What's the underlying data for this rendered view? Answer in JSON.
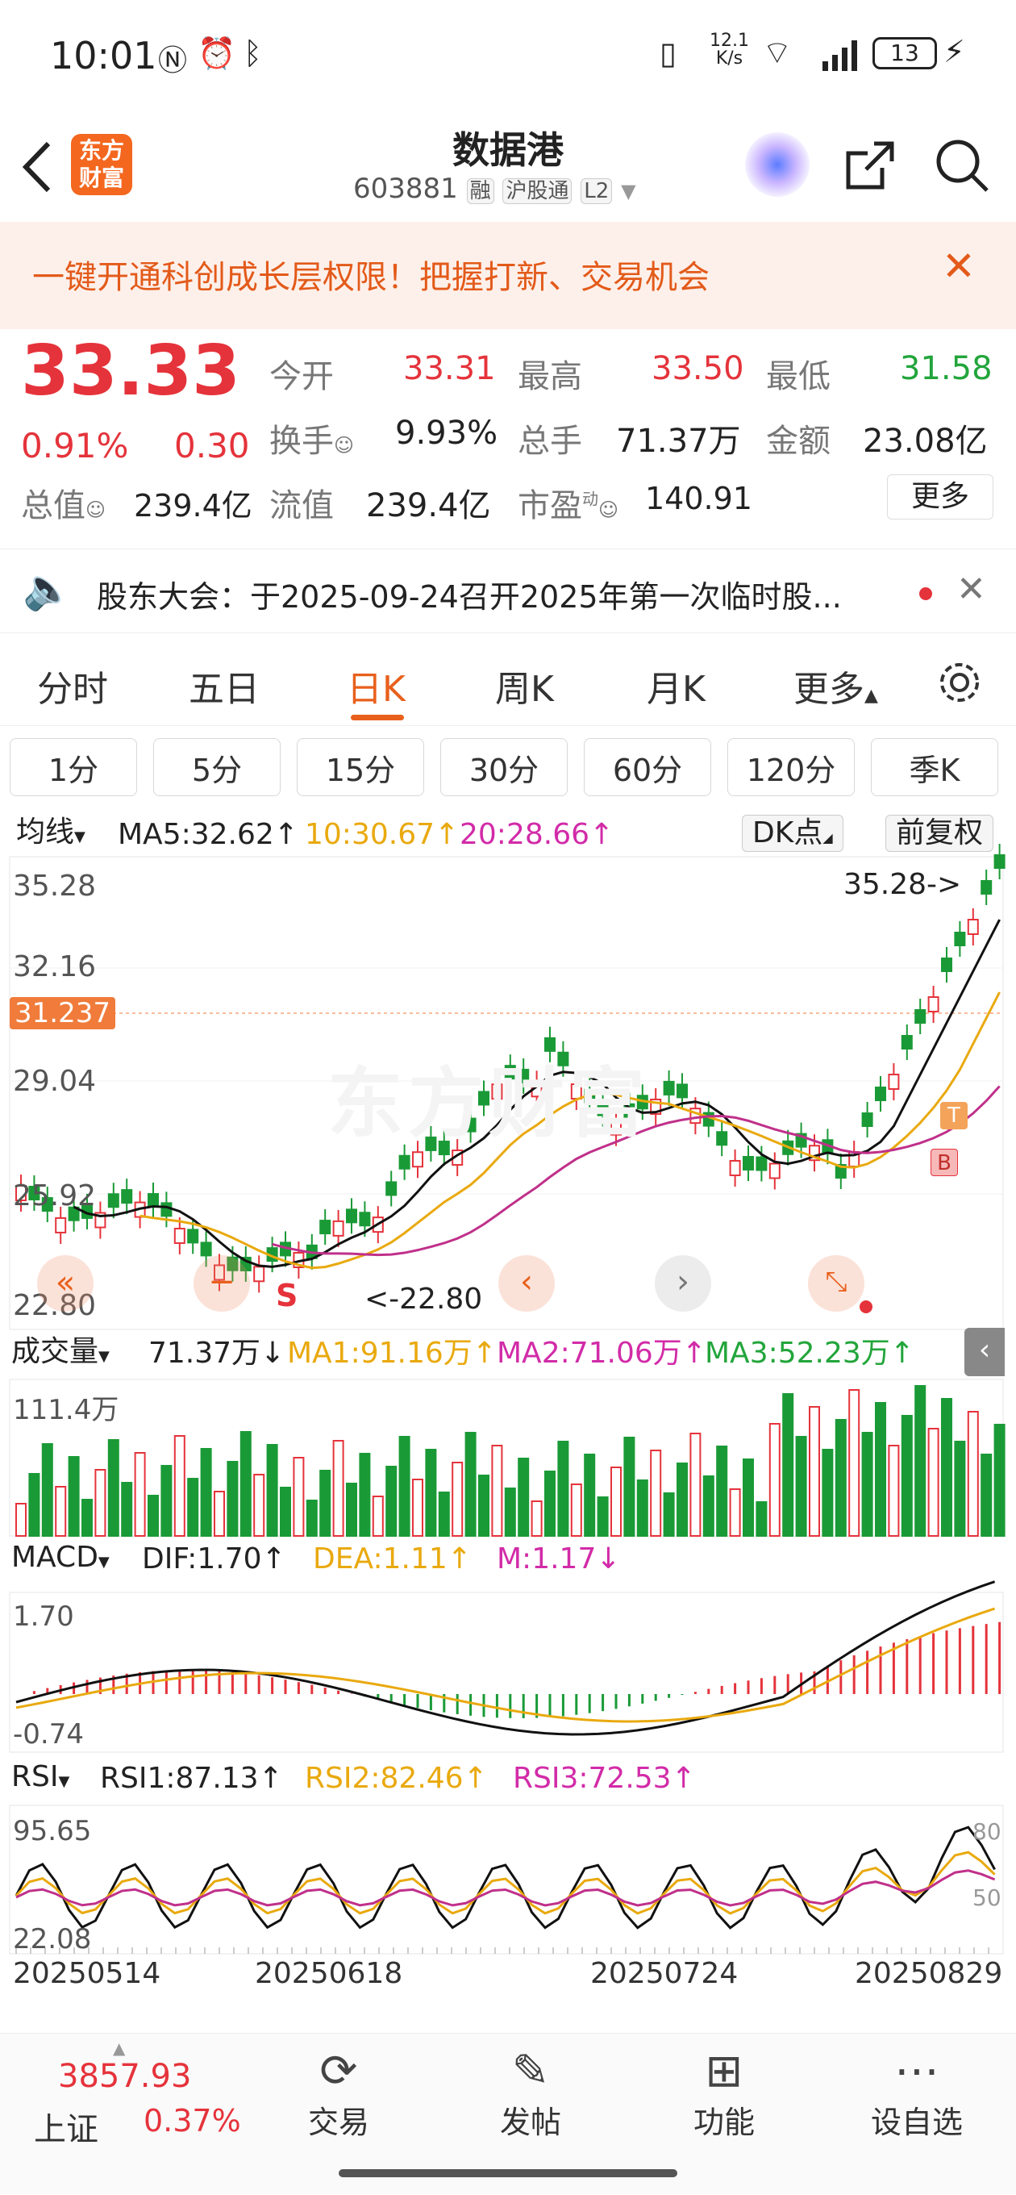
{
  "status": {
    "time": "10:01",
    "net_speed_top": "12.1",
    "net_speed_bottom": "K/s",
    "battery": "13"
  },
  "nav": {
    "title": "数据港",
    "code": "603881",
    "tags": [
      "融",
      "沪股通",
      "L2"
    ],
    "logo_line1": "东方",
    "logo_line2": "财富"
  },
  "banner": {
    "text": "一键开通科创成长层权限！把握打新、交易机会"
  },
  "quote": {
    "price": "33.33",
    "change_pct": "0.91%",
    "change": "0.30",
    "open_label": "今开",
    "open": "33.31",
    "high_label": "最高",
    "high": "33.50",
    "low_label": "最低",
    "low": "31.58",
    "turnover_label": "换手",
    "turnover": "9.93%",
    "volume_label": "总手",
    "volume": "71.37万",
    "amount_label": "金额",
    "amount": "23.08亿",
    "mktcap_label": "总值",
    "mktcap": "239.4亿",
    "float_label": "流值",
    "float_cap": "239.4亿",
    "pe_label": "市盈",
    "pe_sup": "动",
    "pe": "140.91",
    "more": "更多"
  },
  "notice": {
    "text": "股东大会：于2025-09-24召开2025年第一次临时股..."
  },
  "period_tabs": [
    "分时",
    "五日",
    "日K",
    "周K",
    "月K",
    "更多"
  ],
  "active_period": "日K",
  "interval_tabs": [
    "1分",
    "5分",
    "15分",
    "30分",
    "60分",
    "120分",
    "季K"
  ],
  "kline": {
    "ma_dropdown": "均线",
    "ma5": "MA5:32.62↑",
    "ma10": "10:30.67↑",
    "ma20": "20:28.66↑",
    "dk_label": "DK点",
    "fq_label": "前复权",
    "y_labels": [
      "35.28",
      "32.16",
      "29.04",
      "25.92",
      "22.80"
    ],
    "last_price_tag": "31.237",
    "max_annot": "35.28->",
    "min_annot": "<-22.80",
    "s_mark": "S",
    "t_mark": "T",
    "b_mark": "B",
    "watermark": "东方财富"
  },
  "volume": {
    "label": "成交量",
    "vol": "71.37万↓",
    "ma1": "MA1:91.16万↑",
    "ma2": "MA2:71.06万↑",
    "ma3": "MA3:52.23万↑",
    "y_max": "111.4万"
  },
  "macd": {
    "label": "MACD",
    "dif": "DIF:1.70↑",
    "dea": "DEA:1.11↑",
    "m": "M:1.17↓",
    "y_top": "1.70",
    "y_bottom": "-0.74"
  },
  "rsi": {
    "label": "RSI",
    "rsi1": "RSI1:87.13↑",
    "rsi2": "RSI2:82.46↑",
    "rsi3": "RSI3:72.53↑",
    "y_top": "95.65",
    "y_bottom": "22.08",
    "lvl80": "80",
    "lvl50": "50"
  },
  "dates": [
    "20250514",
    "20250618",
    "20250724",
    "20250829"
  ],
  "bottom": {
    "index_value": "3857.93",
    "index_name": "上证",
    "index_change": "0.37%",
    "items": [
      "交易",
      "发帖",
      "功能",
      "设自选"
    ]
  },
  "colors": {
    "up": "#e5333b",
    "down": "#1a9a36",
    "ma5": "#111111",
    "ma10": "#e9a90e",
    "ma20": "#c0308a",
    "accent": "#e8601c"
  }
}
